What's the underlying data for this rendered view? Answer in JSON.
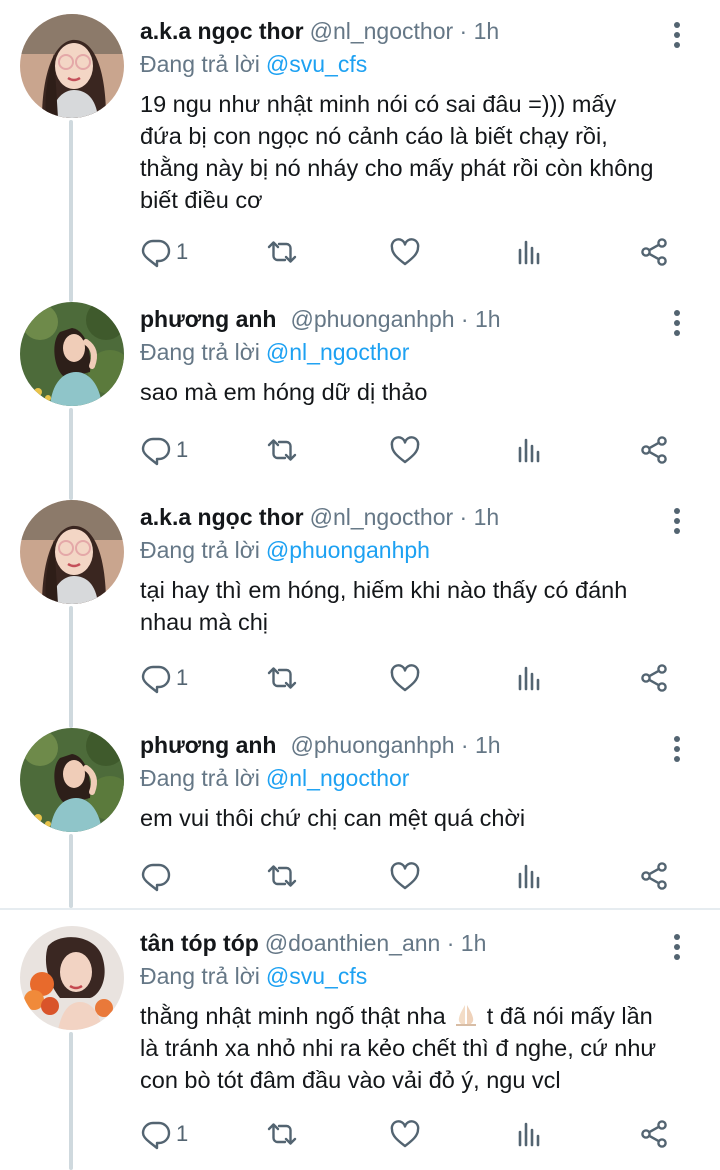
{
  "tweets": [
    {
      "name": "a.k.a ngọc thor",
      "meta": "@nl_ngocthor · 1h",
      "reply_prefix": "Đang trả lời",
      "reply_handle": "@svu_cfs",
      "lines": [
        "19 ngu như nhật minh nói có sai đâu =))) mấy",
        "đứa bị con ngọc nó cảnh cáo là biết chạy rồi,",
        "thằng này bị nó nháy cho mấy phát rồi còn không",
        "biết điều cơ"
      ],
      "reply_count": "1"
    },
    {
      "name": "phương anh",
      "meta": "@phuonganhph · 1h",
      "reply_prefix": "Đang trả lời",
      "reply_handle": "@nl_ngocthor",
      "lines": [
        "sao mà em hóng dữ dị thảo"
      ],
      "reply_count": "1"
    },
    {
      "name": "a.k.a ngọc thor",
      "meta": "@nl_ngocthor · 1h",
      "reply_prefix": "Đang trả lời",
      "reply_handle": "@phuonganhph",
      "lines": [
        "tại hay thì em hóng, hiếm khi nào thấy có đánh",
        "nhau mà chị"
      ],
      "reply_count": "1"
    },
    {
      "name": "phương anh",
      "meta": "@phuonganhph · 1h",
      "reply_prefix": "Đang trả lời",
      "reply_handle": "@nl_ngocthor",
      "lines": [
        "em vui thôi chứ chị can mệt quá chời"
      ],
      "reply_count": ""
    },
    {
      "name": "tân tóp tóp",
      "meta": "@doanthien_ann · 1h",
      "reply_prefix": "Đang trả lời",
      "reply_handle": "@svu_cfs",
      "line1_before": "thằng nhật minh ngố thật nha",
      "line1_after": " t đã nói mấy lần",
      "lines_rest": [
        "là tránh xa nhỏ nhi ra kẻo chết thì đ nghe, cứ như",
        "con bò tót đâm đầu vào vải đỏ ý, ngu vcl"
      ],
      "emoji": "folded-hands-emoji",
      "reply_count": "1"
    }
  ],
  "icons": {
    "reply": "reply-icon",
    "retweet": "retweet-icon",
    "like": "like-icon",
    "analytics": "analytics-icon",
    "share": "share-icon",
    "more": "more-vertical-icon"
  },
  "colors": {
    "handle_blue": "#1da1f2",
    "muted": "#657786",
    "icon_gray": "#536471",
    "thread_line": "#cfd9de"
  }
}
